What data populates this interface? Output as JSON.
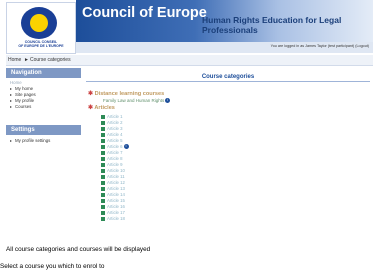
{
  "logo": {
    "caption": "COUNCIL CONSEIL\nOF EUROPE DE L'EUROPE"
  },
  "header": {
    "org_title": "Council of Europe",
    "site_title": "Human Rights Education for Legal Professionals"
  },
  "login": {
    "text": "You are logged in as James Taylor (test participant) (Logout)"
  },
  "breadcrumb": {
    "home": "Home",
    "separator": "►",
    "current": "Course categories"
  },
  "sidebar": {
    "navigation_title": "Navigation",
    "home_label": "Home",
    "nav_items": [
      "My home",
      "Site pages",
      "My profile",
      "Courses"
    ],
    "settings_title": "Settings",
    "settings_items": [
      "My profile settings"
    ]
  },
  "main": {
    "title": "Course categories",
    "categories": [
      {
        "name": "Distance learning courses",
        "sub": "Family Law and Human Rights"
      },
      {
        "name": "Articles"
      }
    ],
    "articles": [
      "Article 1",
      "Article 2",
      "Article 3",
      "Article 4",
      "Article 5",
      "Article 6",
      "Article 7",
      "Article 8",
      "Article 9",
      "Article 10",
      "Article 11",
      "Article 12",
      "Article 13",
      "Article 14",
      "Article 15",
      "Article 16",
      "Article 17",
      "Article 18"
    ],
    "info_articles": [
      "Article 6"
    ]
  },
  "caption": {
    "line1": "All course categories and courses will be displayed",
    "line2": "Select a course you which to enrol to"
  },
  "colors": {
    "accent": "#1d4e9a",
    "category": "#c09a60",
    "link": "#8fb6c8"
  },
  "icons": [
    "council-of-europe-logo",
    "info-icon",
    "course-icon"
  ]
}
